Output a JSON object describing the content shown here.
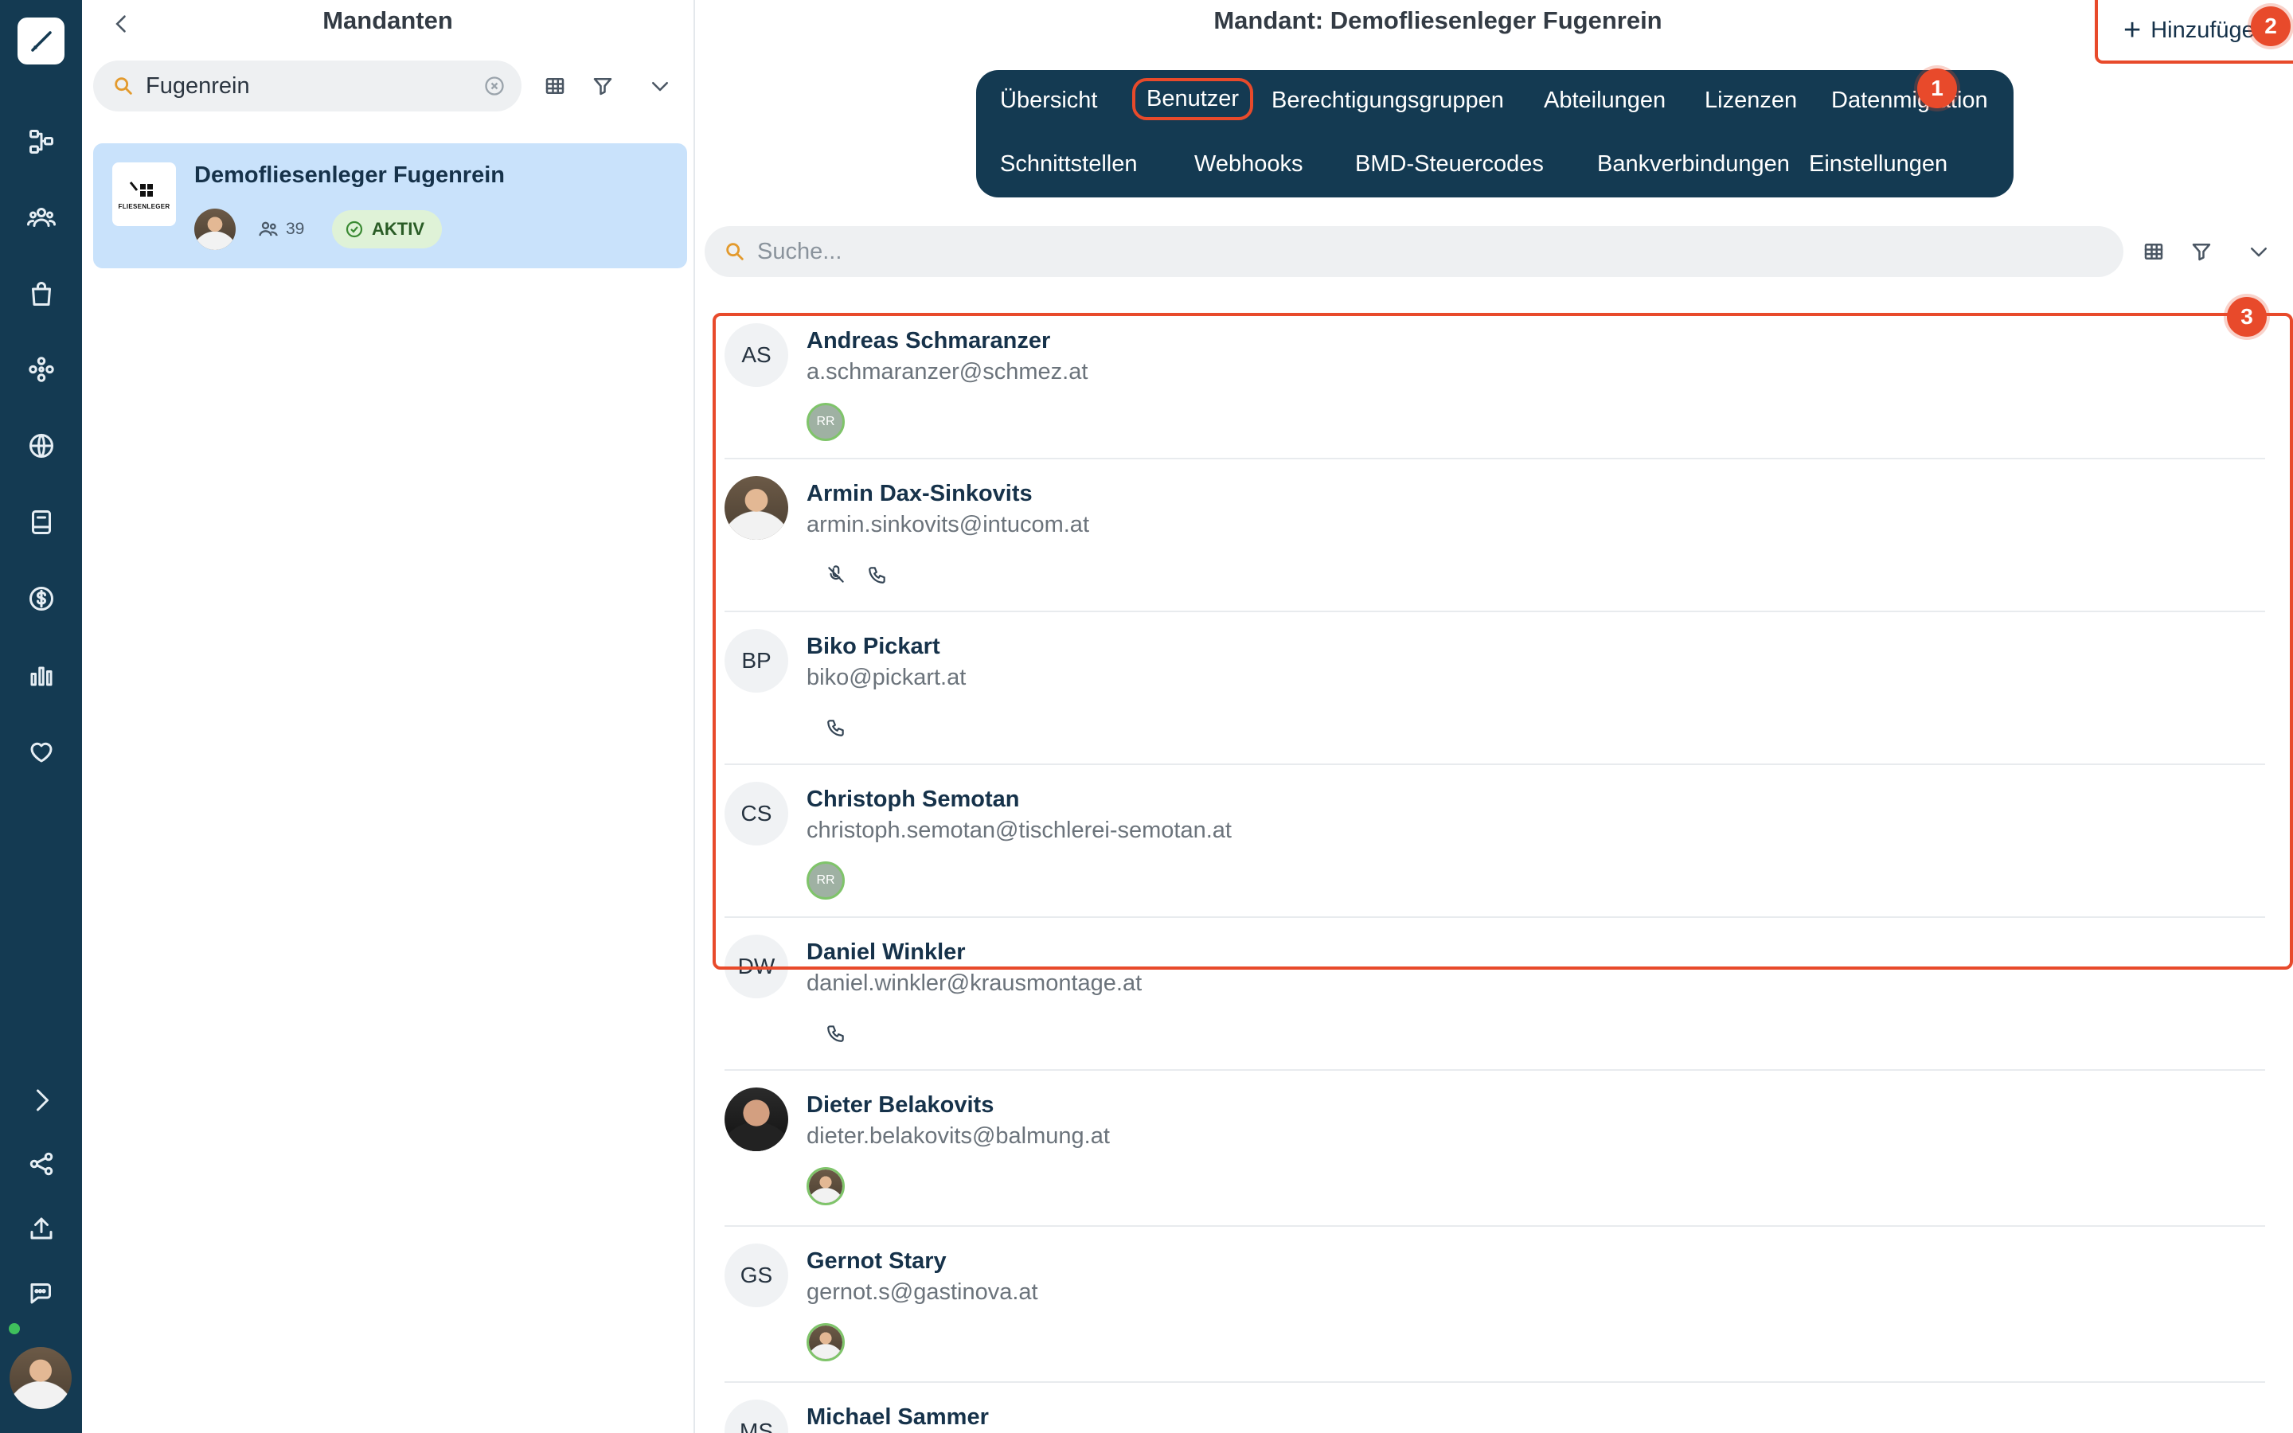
{
  "rail": {
    "items": [
      "logo-icon",
      "workflow-icon",
      "users-icon",
      "bag-icon",
      "modules-icon",
      "globe-icon",
      "book-icon",
      "dollar-icon",
      "chart-icon",
      "heart-icon",
      "chevron-right-icon",
      "share-icon",
      "upload-icon",
      "chat-icon"
    ],
    "status_color": "#3fbf5c"
  },
  "list": {
    "title": "Mandanten",
    "search_value": "Fugenrein",
    "clients": [
      {
        "name": "Demofliesenleger Fugenrein",
        "logo_text": "FLIESENLEGER",
        "user_count": "39",
        "status": "AKTIV"
      }
    ]
  },
  "main": {
    "title": "Mandant: Demofliesenleger Fugenrein",
    "add_label": "Hinzufüge",
    "tabs": {
      "row1": [
        "Übersicht",
        "Benutzer",
        "Berechtigungsgruppen",
        "Abteilungen",
        "Lizenzen",
        "Datenmigration"
      ],
      "row2": [
        "Schnittstellen",
        "Webhooks",
        "BMD-Steuercodes",
        "Bankverbindungen",
        "Einstellungen"
      ],
      "active": "Benutzer"
    },
    "search_placeholder": "Suche...",
    "users": [
      {
        "initials": "AS",
        "name": "Andreas Schmaranzer",
        "email": "a.schmaranzer@schmez.at",
        "meta": [
          "chip-RR"
        ]
      },
      {
        "initials": "",
        "name": "Armin Dax-Sinkovits",
        "email": "armin.sinkovits@intucom.at",
        "meta": [
          "no-mic-icon",
          "phone-icon"
        ]
      },
      {
        "initials": "BP",
        "name": "Biko Pickart",
        "email": "biko@pickart.at",
        "meta": [
          "phone-icon"
        ]
      },
      {
        "initials": "CS",
        "name": "Christoph Semotan",
        "email": "christoph.semotan@tischlerei-semotan.at",
        "meta": [
          "chip-RR"
        ]
      },
      {
        "initials": "DW",
        "name": "Daniel Winkler",
        "email": "daniel.winkler@krausmontage.at",
        "meta": [
          "phone-icon"
        ]
      },
      {
        "initials": "",
        "name": "Dieter Belakovits",
        "email": "dieter.belakovits@balmung.at",
        "meta": [
          "chip-photo"
        ]
      },
      {
        "initials": "GS",
        "name": "Gernot Stary",
        "email": "gernot.s@gastinova.at",
        "meta": [
          "chip-photo"
        ]
      },
      {
        "initials": "MS",
        "name": "Michael Sammer",
        "email": "",
        "meta": []
      }
    ],
    "chip_text": "RR"
  },
  "markers": [
    "1",
    "2",
    "3"
  ],
  "colors": {
    "rail": "#143a52",
    "highlight": "#e84a2b",
    "selected": "#c9e2fb",
    "active_badge": "#dff2d7"
  }
}
